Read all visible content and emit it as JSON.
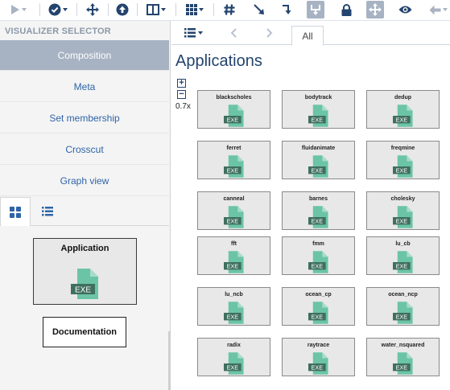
{
  "toolbar": {
    "icons": [
      "play-icon",
      "check-circle-icon",
      "move-arrows-icon",
      "arrow-up-circle-icon",
      "columns-icon",
      "grid-icon",
      "hash-icon",
      "arrow-down-right-icon",
      "step-arrow-icon",
      "merge-icon",
      "lock-icon",
      "move-icon",
      "eye-icon",
      "back-arrow-icon"
    ]
  },
  "left_panel": {
    "title": "VISUALIZER SELECTOR",
    "items": [
      {
        "label": "Composition",
        "active": true
      },
      {
        "label": "Meta",
        "active": false
      },
      {
        "label": "Set membership",
        "active": false
      },
      {
        "label": "Crosscut",
        "active": false
      },
      {
        "label": "Graph view",
        "active": false
      }
    ],
    "view_tabs": [
      "grid-view-icon",
      "list-view-icon"
    ],
    "application_card": {
      "label": "Application",
      "badge": "EXE"
    },
    "documentation_card": {
      "label": "Documentation"
    }
  },
  "right_panel": {
    "tab_all": "All",
    "title": "Applications",
    "zoom_in": "+",
    "zoom_out": "−",
    "zoom_level": "0.7x",
    "badge": "EXE",
    "nodes": [
      "blackscholes",
      "bodytrack",
      "dedup",
      "ferret",
      "fluidanimate",
      "freqmine",
      "canneal",
      "barnes",
      "cholesky",
      "fft",
      "fmm",
      "lu_cb",
      "lu_ncb",
      "ocean_cp",
      "ocean_ncp",
      "radix",
      "raytrace",
      "water_nsquared"
    ]
  },
  "colors": {
    "accent": "#23446e",
    "link": "#2e64a8",
    "active_bg": "#a7b3c3",
    "exe_green": "#6bc4a6",
    "exe_dark": "#3f6f5e"
  }
}
